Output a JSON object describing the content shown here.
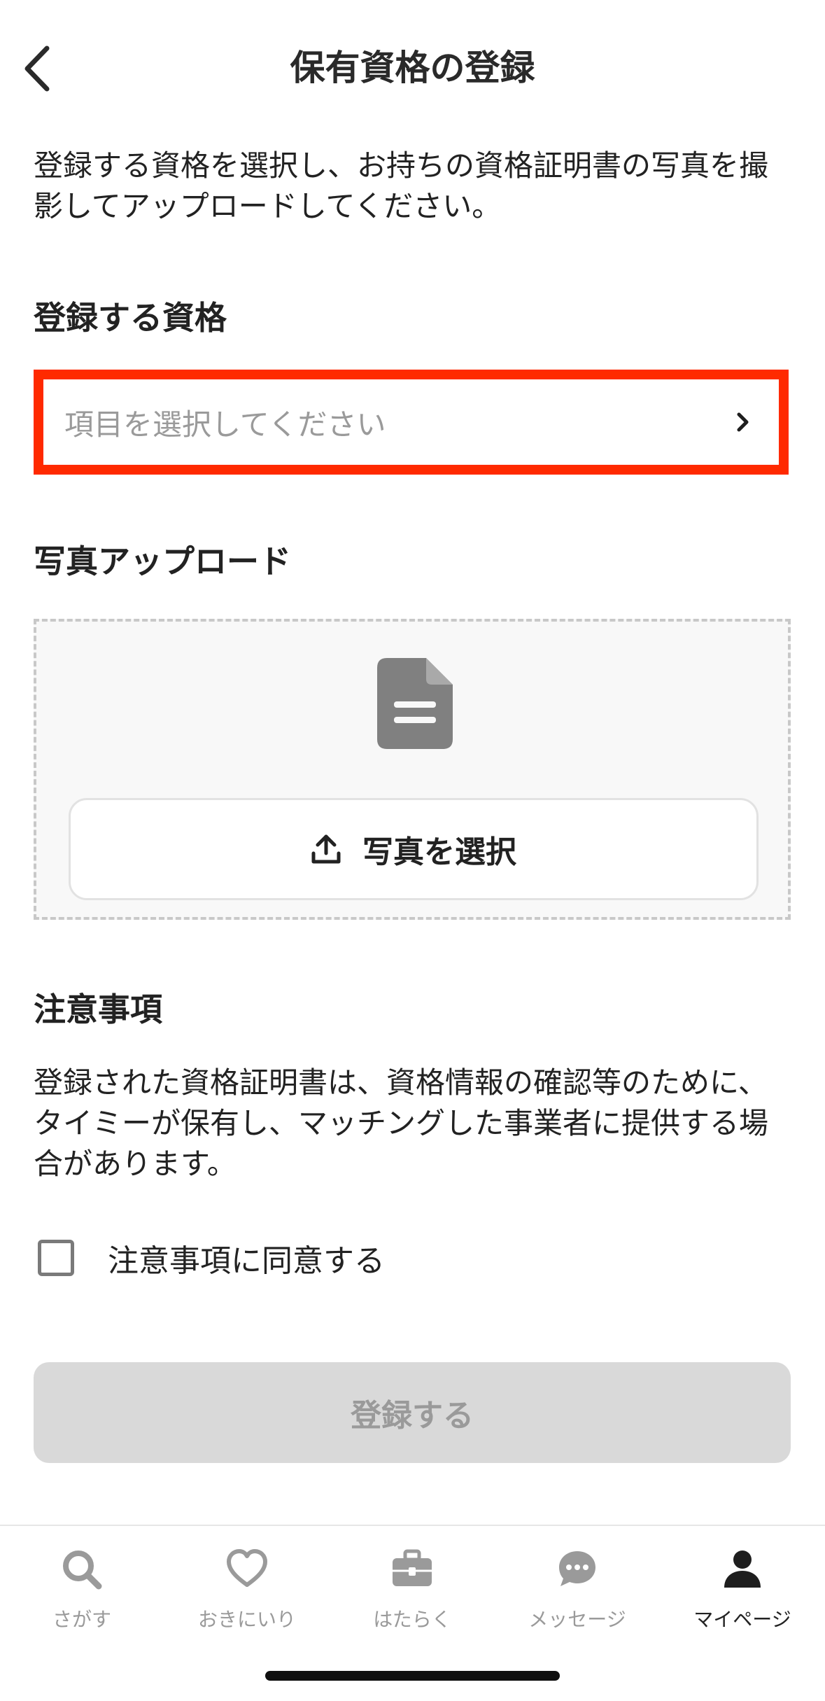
{
  "header": {
    "title": "保有資格の登録",
    "back_icon": "chevron-left-icon"
  },
  "intro_text": "登録する資格を選択し、お持ちの資格証明書の写真を撮影してアップロードしてください。",
  "qualification": {
    "label": "登録する資格",
    "placeholder": "項目を選択してください",
    "highlight_color": "#ff2a00"
  },
  "photo": {
    "label": "写真アップロード",
    "doc_icon": "document-icon",
    "button_label": "写真を選択",
    "button_icon": "upload-icon"
  },
  "notes": {
    "title": "注意事項",
    "body": "登録された資格証明書は、資格情報の確認等のために、タイミーが保有し、マッチングした事業者に提供する場合があります。",
    "agree_label": "注意事項に同意する",
    "agree_checked": false
  },
  "submit": {
    "label": "登録する",
    "disabled": true
  },
  "tabbar": {
    "items": [
      {
        "label": "さがす",
        "icon": "search-icon",
        "active": false
      },
      {
        "label": "おきにいり",
        "icon": "heart-icon",
        "active": false
      },
      {
        "label": "はたらく",
        "icon": "briefcase-icon",
        "active": false
      },
      {
        "label": "メッセージ",
        "icon": "chat-bubble-icon",
        "active": false
      },
      {
        "label": "マイページ",
        "icon": "person-icon",
        "active": true
      }
    ]
  }
}
